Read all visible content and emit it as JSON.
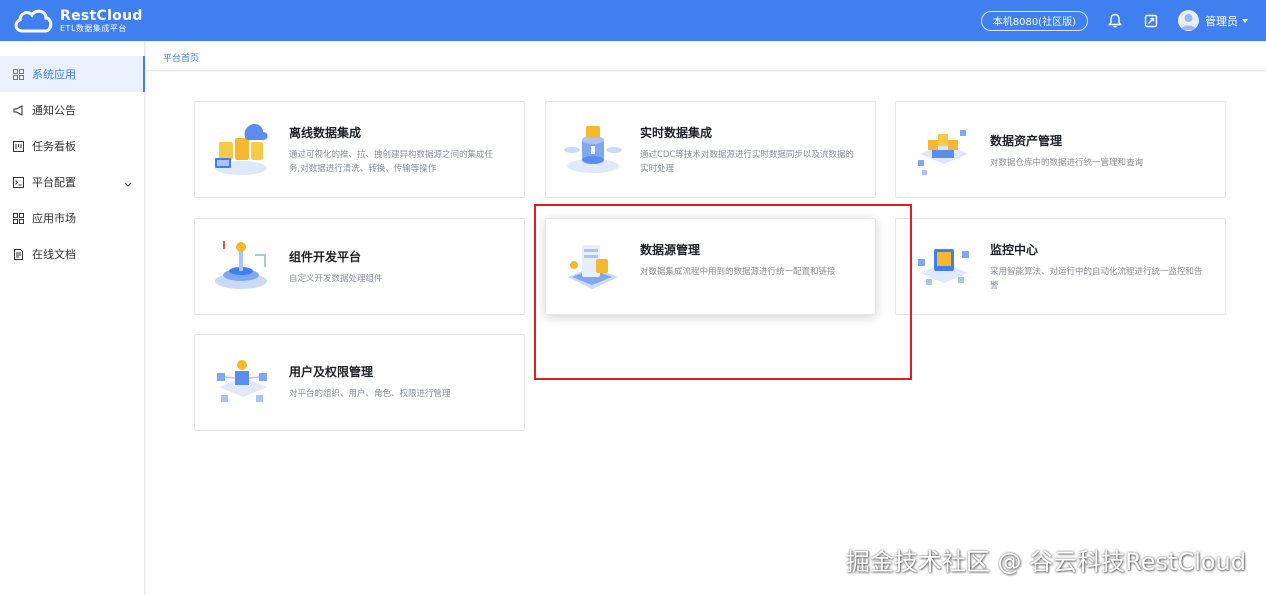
{
  "header": {
    "logo_title": "RestCloud",
    "logo_subtitle": "ETL数据集成平台",
    "env_label": "本机8080(社区版)",
    "user_name": "管理员",
    "brand_color": "#3f7ff0"
  },
  "sidebar": {
    "items": [
      {
        "label": "系统应用",
        "icon": "grid-icon",
        "active": true
      },
      {
        "label": "通知公告",
        "icon": "megaphone-icon"
      },
      {
        "label": "任务看板",
        "icon": "board-icon"
      },
      {
        "label": "平台配置",
        "icon": "terminal-icon",
        "expandable": true
      },
      {
        "label": "应用市场",
        "icon": "grid-icon"
      },
      {
        "label": "在线文档",
        "icon": "document-icon"
      }
    ]
  },
  "breadcrumb": "平台首页",
  "cards": [
    {
      "title": "离线数据集成",
      "desc": "通过可视化的推、拉、拽创建异构数据源之间的集成任务,对数据进行清洗、转换、传输等操作"
    },
    {
      "title": "实时数据集成",
      "desc": "通过CDC等技术对数据源进行实时数据同步以及流数据的实时处理"
    },
    {
      "title": "数据资产管理",
      "desc": "对数据仓库中的数据进行统一管理和查询"
    },
    {
      "title": "组件开发平台",
      "desc": "自定义开发数据处理组件"
    },
    {
      "title": "数据源管理",
      "desc": "对数据集成流程中用到的数据源进行统一配置和链接"
    },
    {
      "title": "监控中心",
      "desc": "采用智能算法、对运行中的自动化流程进行统一监控和告警"
    },
    {
      "title": "用户及权限管理",
      "desc": "对平台的组织、用户、角色、权限进行管理"
    }
  ],
  "watermark": "掘金技术社区 @ 谷云科技RestCloud",
  "highlight_color": "#e11d24"
}
